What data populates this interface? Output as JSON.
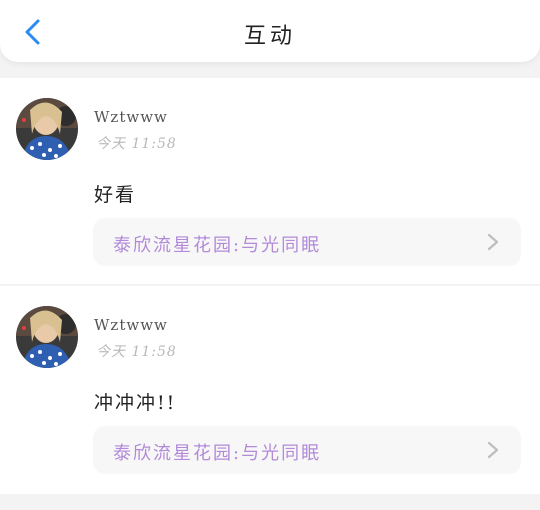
{
  "header": {
    "title": "互动",
    "back_icon": "chevron-left-icon",
    "accent": "#2a8cf0"
  },
  "comments": [
    {
      "username": "Wztwww",
      "time": "今天 11:58",
      "content": "好看",
      "link": "泰欣流星花园:与光同眠",
      "link_icon": "chevron-right-icon"
    },
    {
      "username": "Wztwww",
      "time": "今天 11:58",
      "content": "冲冲冲!!",
      "link": "泰欣流星花园:与光同眠",
      "link_icon": "chevron-right-icon"
    }
  ],
  "colors": {
    "link_text": "#b28ad9",
    "background": "#f3f3f3"
  }
}
